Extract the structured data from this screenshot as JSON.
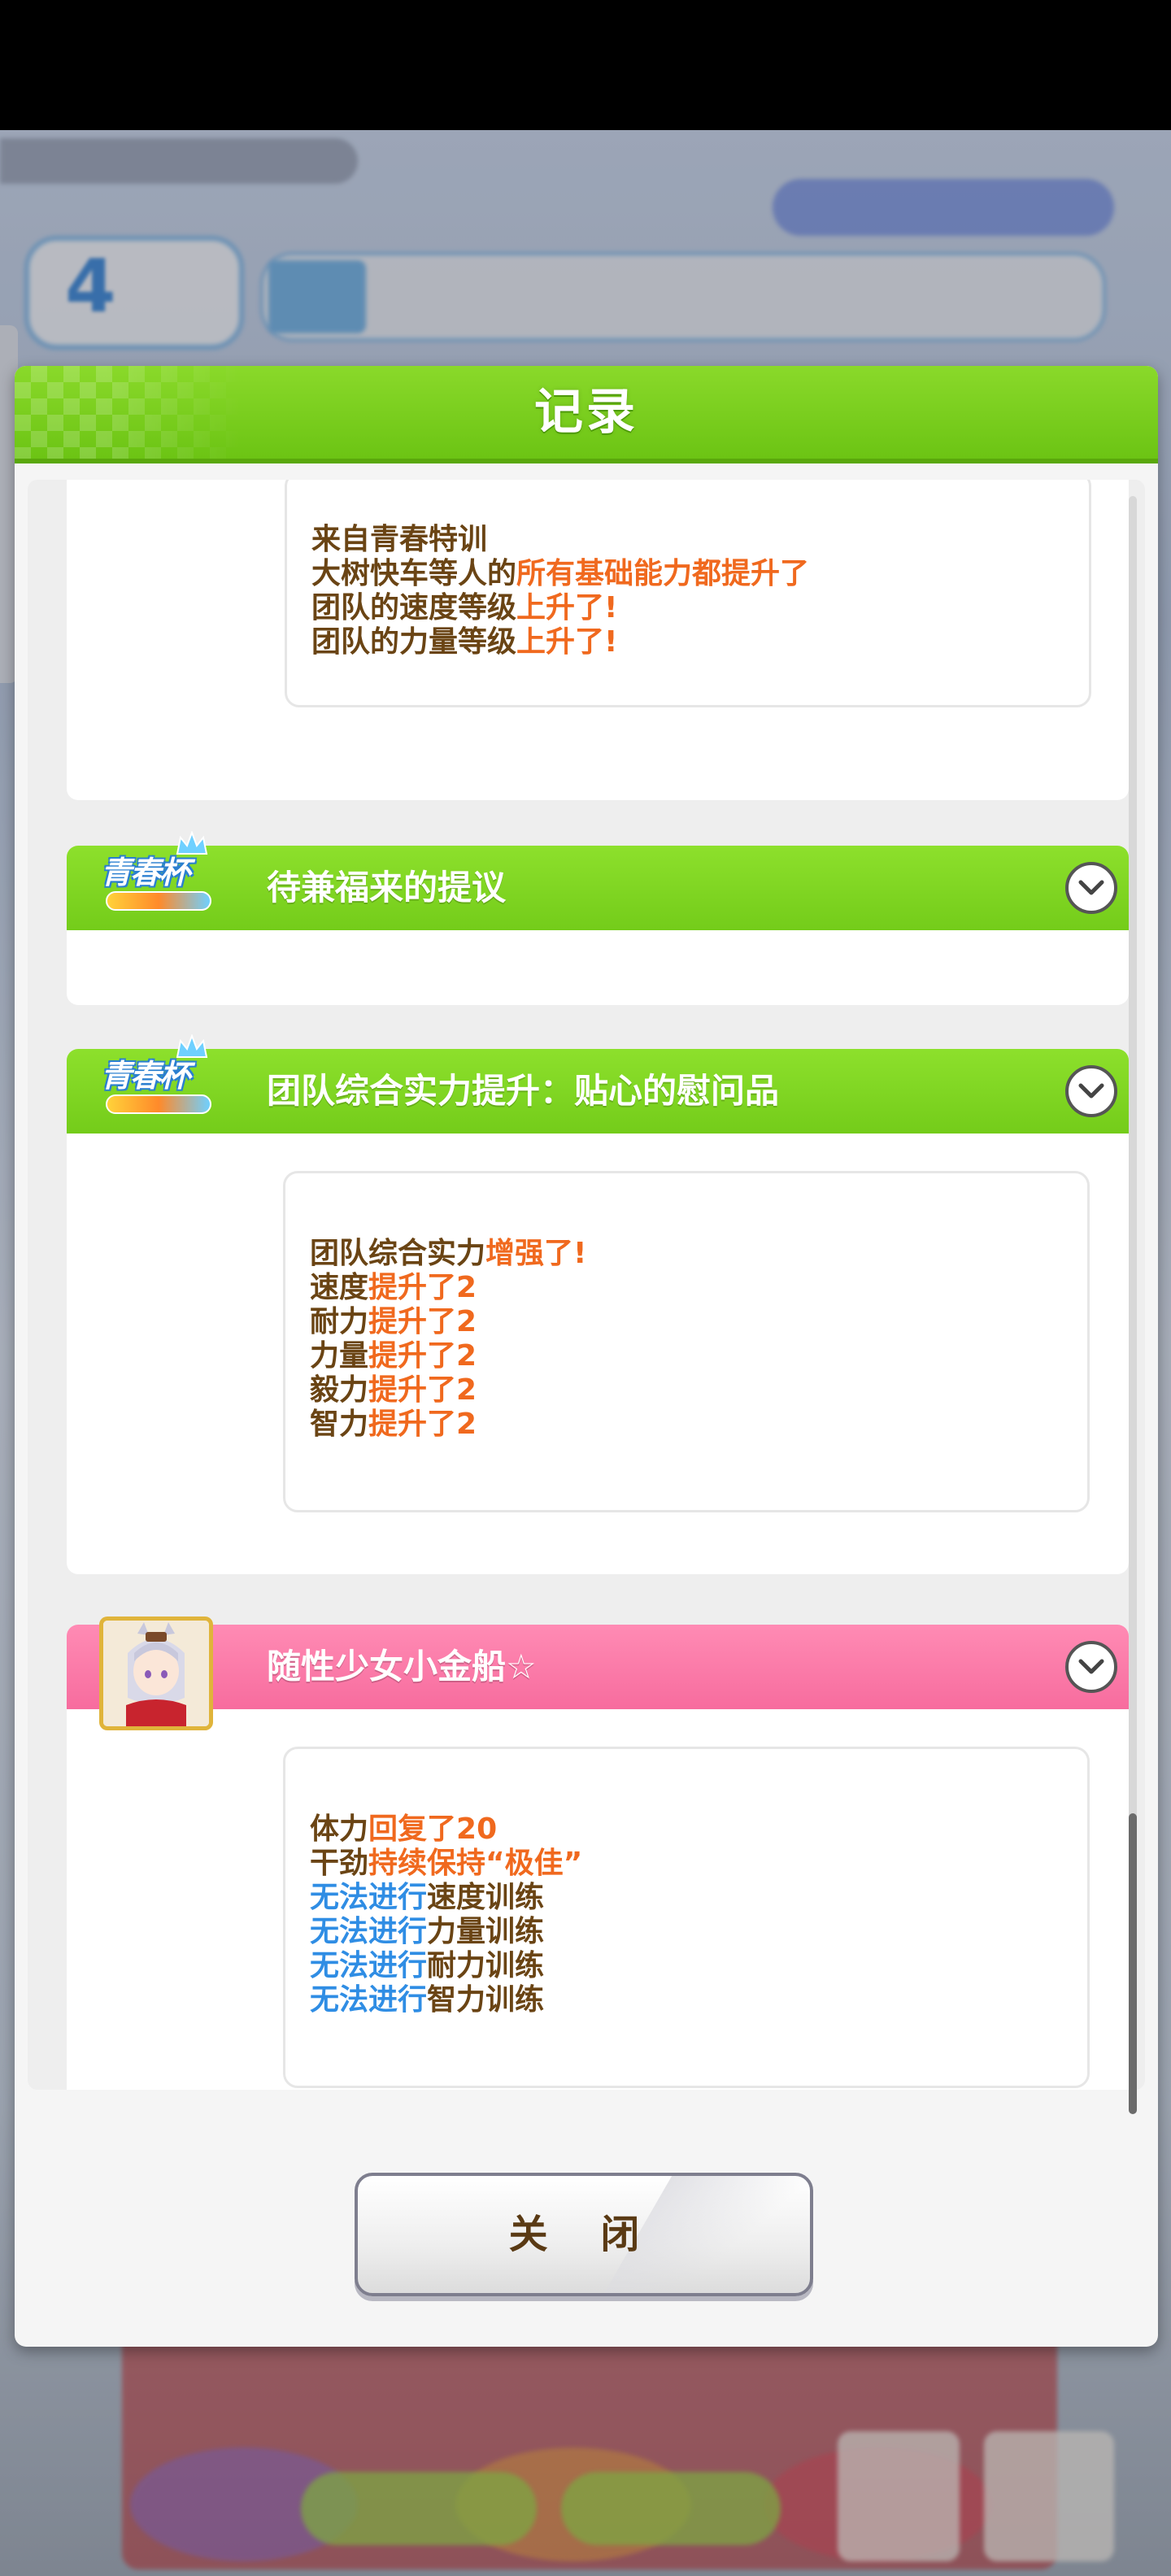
{
  "dialog": {
    "title": "记录",
    "close_label": "关 闭"
  },
  "entries": [
    {
      "lines": [
        [
          {
            "text": "来自青春特训",
            "style": "normal"
          }
        ],
        [
          {
            "text": "大树快车等人的",
            "style": "normal"
          },
          {
            "text": "所有基础能力都提升了",
            "style": "highlight"
          }
        ],
        [
          {
            "text": "团队的速度等级",
            "style": "normal"
          },
          {
            "text": "上升了!",
            "style": "highlight"
          }
        ],
        [
          {
            "text": "团队的力量等级",
            "style": "normal"
          },
          {
            "text": "上升了!",
            "style": "highlight"
          }
        ]
      ]
    },
    {
      "title": "待兼福来的提议",
      "banner_color": "green",
      "icon": "youth-cup-event-logo"
    },
    {
      "title": "团队综合实力提升：贴心的慰问品",
      "banner_color": "green",
      "icon": "youth-cup-event-logo",
      "lines": [
        [
          {
            "text": "团队综合实力",
            "style": "normal"
          },
          {
            "text": "增强了!",
            "style": "highlight"
          }
        ],
        [
          {
            "text": "速度",
            "style": "normal"
          },
          {
            "text": "提升了2",
            "style": "highlight"
          }
        ],
        [
          {
            "text": "耐力",
            "style": "normal"
          },
          {
            "text": "提升了2",
            "style": "highlight"
          }
        ],
        [
          {
            "text": "力量",
            "style": "normal"
          },
          {
            "text": "提升了2",
            "style": "highlight"
          }
        ],
        [
          {
            "text": "毅力",
            "style": "normal"
          },
          {
            "text": "提升了2",
            "style": "highlight"
          }
        ],
        [
          {
            "text": "智力",
            "style": "normal"
          },
          {
            "text": "提升了2",
            "style": "highlight"
          }
        ]
      ]
    },
    {
      "title": "随性少女小金船☆",
      "banner_color": "pink",
      "icon": "character-portrait",
      "lines": [
        [
          {
            "text": "体力",
            "style": "normal"
          },
          {
            "text": "回复了20",
            "style": "highlight"
          }
        ],
        [
          {
            "text": "干劲",
            "style": "normal"
          },
          {
            "text": "持续保持“极佳”",
            "style": "highlight"
          }
        ],
        [
          {
            "text": "无法进行",
            "style": "blue"
          },
          {
            "text": "速度训练",
            "style": "normal"
          }
        ],
        [
          {
            "text": "无法进行",
            "style": "blue"
          },
          {
            "text": "力量训练",
            "style": "normal"
          }
        ],
        [
          {
            "text": "无法进行",
            "style": "blue"
          },
          {
            "text": "耐力训练",
            "style": "normal"
          }
        ],
        [
          {
            "text": "无法进行",
            "style": "blue"
          },
          {
            "text": "智力训练",
            "style": "normal"
          }
        ]
      ]
    }
  ],
  "background": {
    "turn_number": "4"
  },
  "colors": {
    "header_green": "#7ad11f",
    "banner_pink": "#f76c9e",
    "highlight_orange": "#f0691e",
    "blocked_blue": "#2f8de4",
    "body_brown": "#6a4414"
  }
}
